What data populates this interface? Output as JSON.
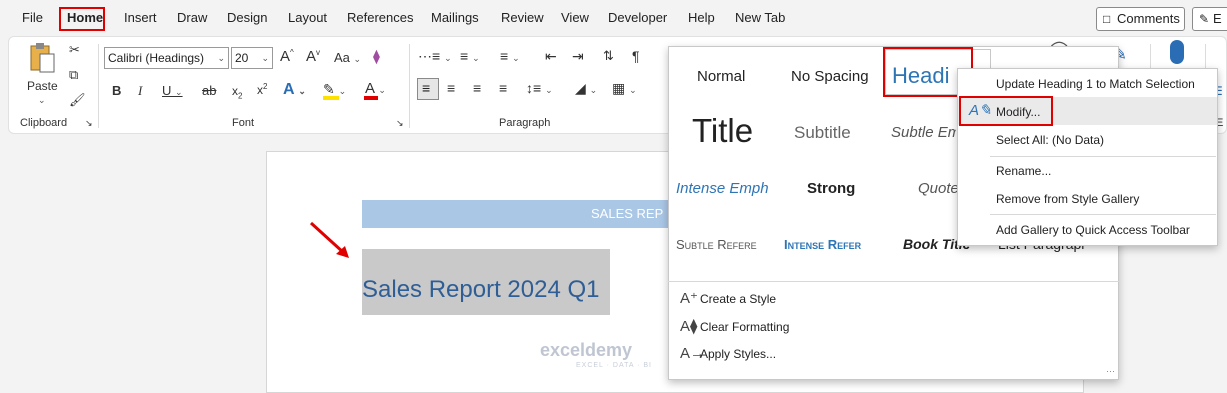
{
  "menubar": {
    "items": [
      "File",
      "Home",
      "Insert",
      "Draw",
      "Design",
      "Layout",
      "References",
      "Mailings",
      "Review",
      "View",
      "Developer",
      "Help",
      "New Tab"
    ],
    "comments_label": "Comments",
    "editing_label": "E"
  },
  "ribbon": {
    "clipboard": {
      "paste_label": "Paste",
      "group_label": "Clipboard"
    },
    "font": {
      "font_name": "Calibri (Headings)",
      "font_size": "20",
      "group_label": "Font"
    },
    "paragraph": {
      "group_label": "Paragraph"
    },
    "editing_partial": "E"
  },
  "document": {
    "banner_text": "SALES REP",
    "heading_text": "Sales Report 2024 Q1",
    "watermark": "exceldemy",
    "watermark_sub": "EXCEL · DATA · BI"
  },
  "styles_gallery": {
    "row1": [
      "Normal",
      "No Spacing",
      "Headi"
    ],
    "row2": [
      "Title",
      "Subtitle",
      "Subtle Em"
    ],
    "row3": [
      "Intense Emph",
      "Strong",
      "Quote"
    ],
    "row4": [
      "Subtle Refere",
      "Intense Refer",
      "Book Title",
      "List Paragrapl"
    ],
    "commands": [
      "Create a Style",
      "Clear Formatting",
      "Apply Styles..."
    ]
  },
  "context_menu": {
    "items": [
      "Update Heading 1 to Match Selection",
      "Modify...",
      "Select All: (No Data)",
      "Rename...",
      "Remove from Style Gallery",
      "Add Gallery to Quick Access Toolbar"
    ]
  },
  "colors": {
    "highlight_red": "#e00000",
    "heading_blue": "#2e5e95",
    "banner_blue": "#aac7e6",
    "selection_gray": "#c9c9c9"
  }
}
